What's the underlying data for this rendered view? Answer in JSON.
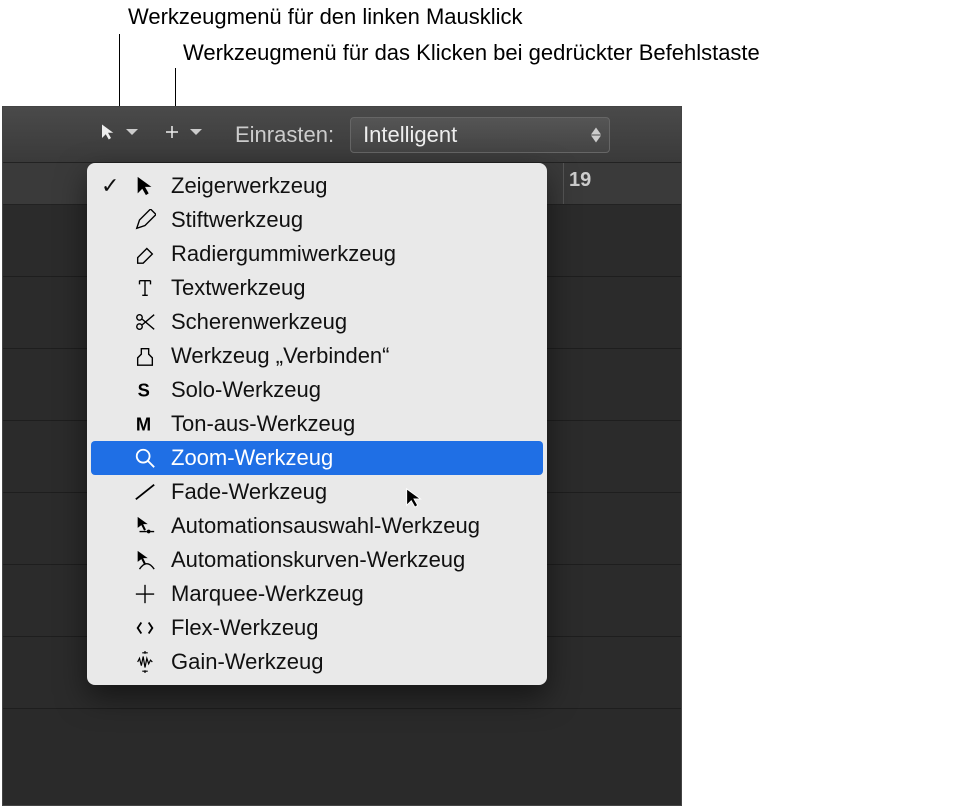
{
  "callouts": {
    "left_click": "Werkzeugmenü für den linken Mausklick",
    "cmd_click": "Werkzeugmenü für das Klicken bei gedrückter Befehlstaste"
  },
  "toolbar": {
    "snap_label": "Einrasten:",
    "snap_value": "Intelligent"
  },
  "ruler": {
    "mark_19": "19"
  },
  "menu": {
    "items": [
      {
        "label": "Zeigerwerkzeug",
        "icon": "pointer",
        "checked": true
      },
      {
        "label": "Stiftwerkzeug",
        "icon": "pencil",
        "checked": false
      },
      {
        "label": "Radiergummiwerkzeug",
        "icon": "eraser",
        "checked": false
      },
      {
        "label": "Textwerkzeug",
        "icon": "text",
        "checked": false
      },
      {
        "label": "Scherenwerkzeug",
        "icon": "scissors",
        "checked": false
      },
      {
        "label": "Werkzeug „Verbinden“",
        "icon": "glue",
        "checked": false
      },
      {
        "label": "Solo-Werkzeug",
        "icon": "solo",
        "checked": false
      },
      {
        "label": "Ton-aus-Werkzeug",
        "icon": "mute",
        "checked": false
      },
      {
        "label": "Zoom-Werkzeug",
        "icon": "zoom",
        "checked": false,
        "highlighted": true
      },
      {
        "label": "Fade-Werkzeug",
        "icon": "fade",
        "checked": false
      },
      {
        "label": "Automationsauswahl-Werkzeug",
        "icon": "autoselect",
        "checked": false
      },
      {
        "label": "Automationskurven-Werkzeug",
        "icon": "autocurve",
        "checked": false
      },
      {
        "label": "Marquee-Werkzeug",
        "icon": "marquee",
        "checked": false
      },
      {
        "label": "Flex-Werkzeug",
        "icon": "flex",
        "checked": false
      },
      {
        "label": "Gain-Werkzeug",
        "icon": "gain",
        "checked": false
      }
    ]
  }
}
